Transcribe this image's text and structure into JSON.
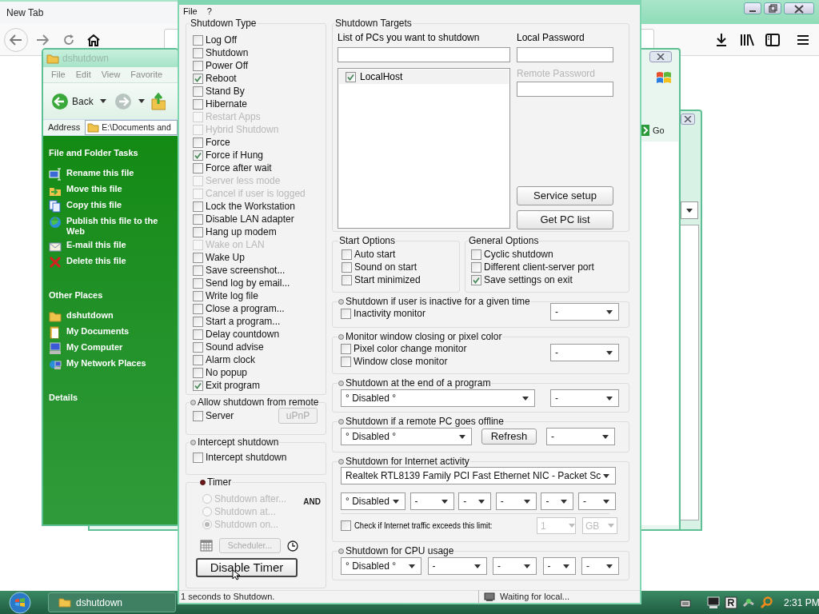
{
  "browser": {
    "tab_title": "New Tab"
  },
  "explorer": {
    "title": "dshutdown",
    "menu": [
      "File",
      "Edit",
      "View",
      "Favorite"
    ],
    "back_label": "Back",
    "address_label": "Address",
    "address": "E:\\Documents and",
    "task_groups": [
      {
        "title": "File and Folder Tasks",
        "items": [
          "Rename this file",
          "Move this file",
          "Copy this file",
          "Publish this file to the Web",
          "E-mail this file",
          "Delete this file"
        ]
      },
      {
        "title": "Other Places",
        "items": [
          "dshutdown",
          "My Documents",
          "My Computer",
          "My Network Places"
        ]
      },
      {
        "title": "Details"
      }
    ]
  },
  "back_window": {
    "go_label": "Go"
  },
  "dialog": {
    "menu": [
      "File",
      "?"
    ],
    "shutdown_type": {
      "title": "Shutdown Type",
      "options": [
        {
          "label": "Log Off",
          "checked": false,
          "disabled": false
        },
        {
          "label": "Shutdown",
          "checked": false,
          "disabled": false
        },
        {
          "label": "Power Off",
          "checked": false,
          "disabled": false
        },
        {
          "label": "Reboot",
          "checked": true,
          "disabled": false
        },
        {
          "label": "Stand By",
          "checked": false,
          "disabled": false
        },
        {
          "label": "Hibernate",
          "checked": false,
          "disabled": false
        },
        {
          "label": "Restart Apps",
          "checked": false,
          "disabled": true
        },
        {
          "label": "Hybrid Shutdown",
          "checked": false,
          "disabled": true
        },
        {
          "label": "Force",
          "checked": false,
          "disabled": false
        },
        {
          "label": "Force if Hung",
          "checked": true,
          "disabled": false
        },
        {
          "label": "Force after wait",
          "checked": false,
          "disabled": false
        },
        {
          "label": "Server less mode",
          "checked": false,
          "disabled": true
        },
        {
          "label": "Cancel if user is logged",
          "checked": false,
          "disabled": true
        },
        {
          "label": "Lock the Workstation",
          "checked": false,
          "disabled": false
        },
        {
          "label": "Disable LAN adapter",
          "checked": false,
          "disabled": false
        },
        {
          "label": "Hang up modem",
          "checked": false,
          "disabled": false
        },
        {
          "label": "Wake on LAN",
          "checked": false,
          "disabled": true
        },
        {
          "label": "Wake Up",
          "checked": false,
          "disabled": false
        },
        {
          "label": "Save screenshot...",
          "checked": false,
          "disabled": false
        },
        {
          "label": "Send log by email...",
          "checked": false,
          "disabled": false
        },
        {
          "label": "Write log file",
          "checked": false,
          "disabled": false
        },
        {
          "label": "Close a program...",
          "checked": false,
          "disabled": false
        },
        {
          "label": "Start a program...",
          "checked": false,
          "disabled": false
        },
        {
          "label": "Delay countdown",
          "checked": false,
          "disabled": false
        },
        {
          "label": "Sound advise",
          "checked": false,
          "disabled": false
        },
        {
          "label": "Alarm clock",
          "checked": false,
          "disabled": false
        },
        {
          "label": "No popup",
          "checked": false,
          "disabled": false
        },
        {
          "label": "Exit program",
          "checked": true,
          "disabled": false
        }
      ]
    },
    "remote": {
      "title": "Allow shutdown from remote",
      "active": false,
      "server": {
        "label": "Server",
        "checked": false
      },
      "upnp": "uPnP"
    },
    "intercept": {
      "title": "Intercept shutdown",
      "active": false,
      "option": {
        "label": "Intercept shutdown",
        "checked": false
      }
    },
    "timer": {
      "title": "Timer",
      "active": true,
      "and_label": "AND",
      "modes": [
        {
          "label": "Shutdown after...",
          "selected": false
        },
        {
          "label": "Shutdown at...",
          "selected": false
        },
        {
          "label": "Shutdown on...",
          "selected": true
        }
      ],
      "scheduler": "Scheduler...",
      "button": "Disable Timer"
    },
    "targets": {
      "title": "Shutdown Targets",
      "list_label": "List of PCs you want to shutdown",
      "pcs": [
        {
          "name": "LocalHost",
          "checked": true
        }
      ],
      "local_password": "Local Password",
      "remote_password": "Remote Password",
      "buttons": [
        "Service setup",
        "Get PC list"
      ]
    },
    "start_options": {
      "title": "Start Options",
      "options": [
        {
          "label": "Auto start",
          "checked": false
        },
        {
          "label": "Sound on start",
          "checked": false
        },
        {
          "label": "Start minimized",
          "checked": false
        }
      ]
    },
    "general_options": {
      "title": "General Options",
      "options": [
        {
          "label": "Cyclic shutdown",
          "checked": false
        },
        {
          "label": "Different client-server port",
          "checked": false
        },
        {
          "label": "Save settings on exit",
          "checked": true
        }
      ]
    },
    "sections": [
      {
        "kind": "checks_select",
        "title": "Shutdown if user is inactive for a given time",
        "active": false,
        "options": [
          {
            "label": "Inactivity monitor",
            "checked": false
          }
        ],
        "selects": [
          "-"
        ]
      },
      {
        "kind": "checks_select",
        "title": "Monitor window closing or pixel color",
        "active": false,
        "options": [
          {
            "label": "Pixel color change monitor",
            "checked": false
          },
          {
            "label": "Window close monitor",
            "checked": false
          }
        ],
        "selects": [
          "-"
        ]
      },
      {
        "kind": "selects",
        "title": "Shutdown at the end of a program",
        "active": false,
        "selects": [
          "° Disabled °",
          "-"
        ]
      },
      {
        "kind": "select_button",
        "title": "Shutdown if a remote PC goes offline",
        "active": false,
        "selects": [
          "° Disabled °",
          "-"
        ],
        "button": "Refresh"
      },
      {
        "kind": "internet",
        "title": "Shutdown for Internet activity",
        "active": false,
        "adapter": "Realtek RTL8139 Family PCI Fast Ethernet NIC - Packet Sc",
        "selects": [
          "° Disabled",
          "-",
          "-",
          "-",
          "-",
          "-"
        ],
        "limit": {
          "label": "Check if Internet traffic exceeds this limit:",
          "checked": false,
          "value": "1",
          "unit": "GB"
        }
      },
      {
        "kind": "selects",
        "title": "Shutdown for CPU usage",
        "active": false,
        "selects": [
          "° Disabled °",
          "-",
          "-",
          "-",
          "-"
        ]
      }
    ]
  },
  "status_bar": [
    "1 seconds to Shutdown.",
    "Waiting for local..."
  ],
  "taskbar": {
    "items": [
      {
        "label": "dshutdown",
        "selected": false
      }
    ],
    "clock": "2:31 PM"
  }
}
